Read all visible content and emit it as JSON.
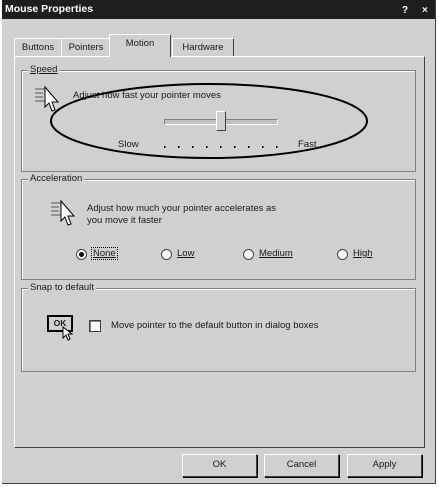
{
  "window": {
    "title": "Mouse Properties",
    "help_label": "?",
    "close_label": "×"
  },
  "tabs": [
    {
      "label": "Buttons",
      "active": false
    },
    {
      "label": "Pointers",
      "active": false
    },
    {
      "label": "Motion",
      "active": true
    },
    {
      "label": "Hardware",
      "active": false
    }
  ],
  "speed": {
    "legend": "Speed",
    "description": "Adjust how fast your pointer moves",
    "slow_label": "Slow",
    "fast_label": "Fast",
    "slider_value": 0.5
  },
  "acceleration": {
    "legend": "Acceleration",
    "description_line1": "Adjust how much your pointer accelerates as",
    "description_line2": "you move it faster",
    "options": [
      {
        "label": "None",
        "selected": true
      },
      {
        "label": "Low",
        "selected": false
      },
      {
        "label": "Medium",
        "selected": false
      },
      {
        "label": "High",
        "selected": false
      }
    ]
  },
  "snap": {
    "legend": "Snap to default",
    "icon_button_label": "OK",
    "checkbox_label": "Move pointer to the default button in dialog boxes",
    "checked": false
  },
  "footer": {
    "ok_label": "OK",
    "cancel_label": "Cancel",
    "apply_label": "Apply"
  }
}
